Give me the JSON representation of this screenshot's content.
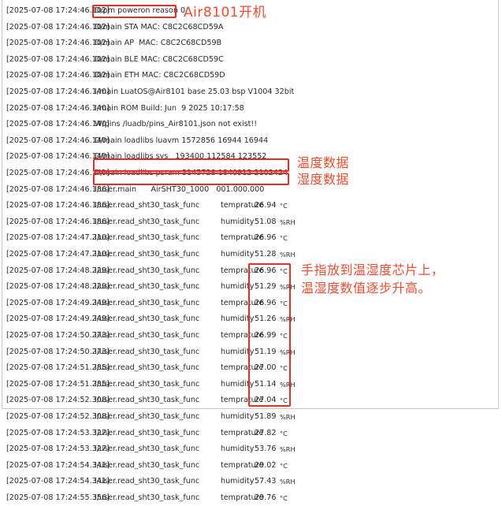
{
  "log": {
    "lines": [
      {
        "ts": "[2025-07-08 17:24:46.102]",
        "msg": "D/pm poweron reason 0"
      },
      {
        "ts": "[2025-07-08 17:24:46.102]",
        "msg": "D/main STA MAC: C8C2C68CD59A"
      },
      {
        "ts": "[2025-07-08 17:24:46.102]",
        "msg": "D/main AP  MAC: C8C2C68CD59B"
      },
      {
        "ts": "[2025-07-08 17:24:46.102]",
        "msg": "D/main BLE MAC: C8C2C68CD59C"
      },
      {
        "ts": "[2025-07-08 17:24:46.102]",
        "msg": "D/main ETH MAC: C8C2C68CD59D"
      },
      {
        "ts": "[2025-07-08 17:24:46.140]",
        "msg": "I/main LuatOS@Air8101 base 25.03 bsp V1004 32bit"
      },
      {
        "ts": "[2025-07-08 17:24:46.140]",
        "msg": "I/main ROM Build: Jun  9 2025 10:17:58"
      },
      {
        "ts": "[2025-07-08 17:24:46.140]",
        "msg": "W/pins /luadb/pins_Air8101.json not exist!!"
      },
      {
        "ts": "[2025-07-08 17:24:46.140]",
        "msg": "D/main loadlibs luavm 1572856 16944 16944"
      },
      {
        "ts": "[2025-07-08 17:24:46.140]",
        "msg": "D/main loadlibs sys   193400 112584 123552"
      },
      {
        "ts": "[2025-07-08 17:24:46.140]",
        "msg": "D/main loadlibs psram 3145728 1840912 2102424"
      },
      {
        "ts": "[2025-07-08 17:24:46.186]",
        "msg": "I/user.main      AirSHT30_1000   001.000.000"
      }
    ],
    "sensor_lines": [
      {
        "ts": "[2025-07-08 17:24:46.186]",
        "func": "I/user.read_sht30_task_func",
        "name": "temprature",
        "value": "26.94",
        "unit": "°C"
      },
      {
        "ts": "[2025-07-08 17:24:46.186]",
        "func": "I/user.read_sht30_task_func",
        "name": "humidity",
        "value": "51.08",
        "unit": "%RH"
      },
      {
        "ts": "[2025-07-08 17:24:47.210]",
        "func": "I/user.read_sht30_task_func",
        "name": "temprature",
        "value": "26.96",
        "unit": "°C"
      },
      {
        "ts": "[2025-07-08 17:24:47.210]",
        "func": "I/user.read_sht30_task_func",
        "name": "humidity",
        "value": "51.28",
        "unit": "%RH"
      },
      {
        "ts": "[2025-07-08 17:24:48.229]",
        "func": "I/user.read_sht30_task_func",
        "name": "temprature",
        "value": "26.96",
        "unit": "°C"
      },
      {
        "ts": "[2025-07-08 17:24:48.229]",
        "func": "I/user.read_sht30_task_func",
        "name": "humidity",
        "value": "51.29",
        "unit": "%RH"
      },
      {
        "ts": "[2025-07-08 17:24:49.249]",
        "func": "I/user.read_sht30_task_func",
        "name": "temprature",
        "value": "26.96",
        "unit": "°C"
      },
      {
        "ts": "[2025-07-08 17:24:49.249]",
        "func": "I/user.read_sht30_task_func",
        "name": "humidity",
        "value": "51.26",
        "unit": "%RH"
      },
      {
        "ts": "[2025-07-08 17:24:50.273]",
        "func": "I/user.read_sht30_task_func",
        "name": "temprature",
        "value": "26.99",
        "unit": "°C"
      },
      {
        "ts": "[2025-07-08 17:24:50.273]",
        "func": "I/user.read_sht30_task_func",
        "name": "humidity",
        "value": "51.19",
        "unit": "%RH"
      },
      {
        "ts": "[2025-07-08 17:24:51.285]",
        "func": "I/user.read_sht30_task_func",
        "name": "temprature",
        "value": "27.00",
        "unit": "°C"
      },
      {
        "ts": "[2025-07-08 17:24:51.285]",
        "func": "I/user.read_sht30_task_func",
        "name": "humidity",
        "value": "51.14",
        "unit": "%RH"
      },
      {
        "ts": "[2025-07-08 17:24:52.308]",
        "func": "I/user.read_sht30_task_func",
        "name": "temprature",
        "value": "27.04",
        "unit": "°C"
      },
      {
        "ts": "[2025-07-08 17:24:52.308]",
        "func": "I/user.read_sht30_task_func",
        "name": "humidity",
        "value": "51.89",
        "unit": "%RH"
      },
      {
        "ts": "[2025-07-08 17:24:53.327]",
        "func": "I/user.read_sht30_task_func",
        "name": "temprature",
        "value": "27.82",
        "unit": "°C"
      },
      {
        "ts": "[2025-07-08 17:24:53.327]",
        "func": "I/user.read_sht30_task_func",
        "name": "humidity",
        "value": "53.76",
        "unit": "%RH"
      },
      {
        "ts": "[2025-07-08 17:24:54.341]",
        "func": "I/user.read_sht30_task_func",
        "name": "temprature",
        "value": "29.02",
        "unit": "°C"
      },
      {
        "ts": "[2025-07-08 17:24:54.341]",
        "func": "I/user.read_sht30_task_func",
        "name": "humidity",
        "value": "57.43",
        "unit": "%RH"
      },
      {
        "ts": "[2025-07-08 17:24:55.356]",
        "func": "I/user.read_sht30_task_func",
        "name": "temprature",
        "value": "29.76",
        "unit": "°C"
      }
    ]
  },
  "annotations": {
    "boot": "Air8101开机",
    "temperature_data": "温度数据",
    "humidity_data": "湿度数据",
    "finger_note_line1": "手指放到温湿度芯片上，",
    "finger_note_line2": "温湿度数值逐步升高。"
  },
  "colors": {
    "highlight": "#e0302a",
    "annotation_text": "#ea4e2f",
    "log_text": "#2a2a2a"
  }
}
